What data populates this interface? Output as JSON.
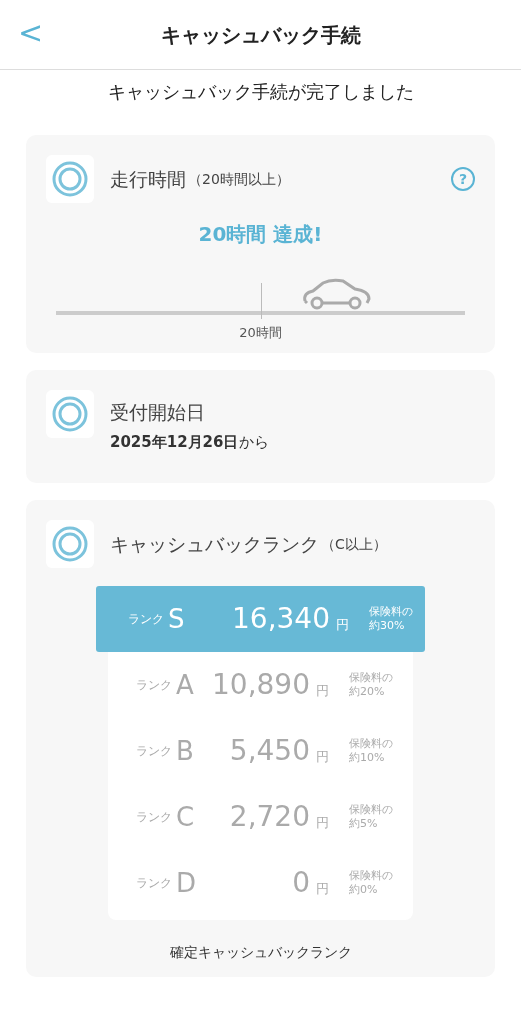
{
  "header": {
    "back": "<",
    "title": "キャッシュバック手続"
  },
  "message": "キャッシュバック手続が完了しました",
  "drive_card": {
    "title": "走行時間",
    "condition": "（20時間以上）",
    "help": "?",
    "result": "20時間 達成!",
    "tick_label": "20時間"
  },
  "start_card": {
    "title": "受付開始日",
    "date": "**2025年12月26日**から"
  },
  "rank_card": {
    "title": "キャッシュバックランク",
    "condition": "（C以上）",
    "caption": "確定キャッシュバックランク",
    "ranks": [
      {
        "prefix": "ランク",
        "letter": "S",
        "amount": "16,340",
        "unit": "円",
        "note_lines": [
          "保険料の",
          "約30%"
        ],
        "selected": true
      },
      {
        "prefix": "ランク",
        "letter": "A",
        "amount": "10,890",
        "unit": "円",
        "note_lines": [
          "保険料の",
          "約20%"
        ],
        "selected": false
      },
      {
        "prefix": "ランク",
        "letter": "B",
        "amount": "5,450",
        "unit": "円",
        "note_lines": [
          "保険料の",
          "約10%"
        ],
        "selected": false
      },
      {
        "prefix": "ランク",
        "letter": "C",
        "amount": "2,720",
        "unit": "円",
        "note_lines": [
          "保険料の",
          "約5%"
        ],
        "selected": false
      },
      {
        "prefix": "ランク",
        "letter": "D",
        "amount": "0",
        "unit": "円",
        "note_lines": [
          "保険料の",
          "約0%"
        ],
        "selected": false
      }
    ]
  }
}
